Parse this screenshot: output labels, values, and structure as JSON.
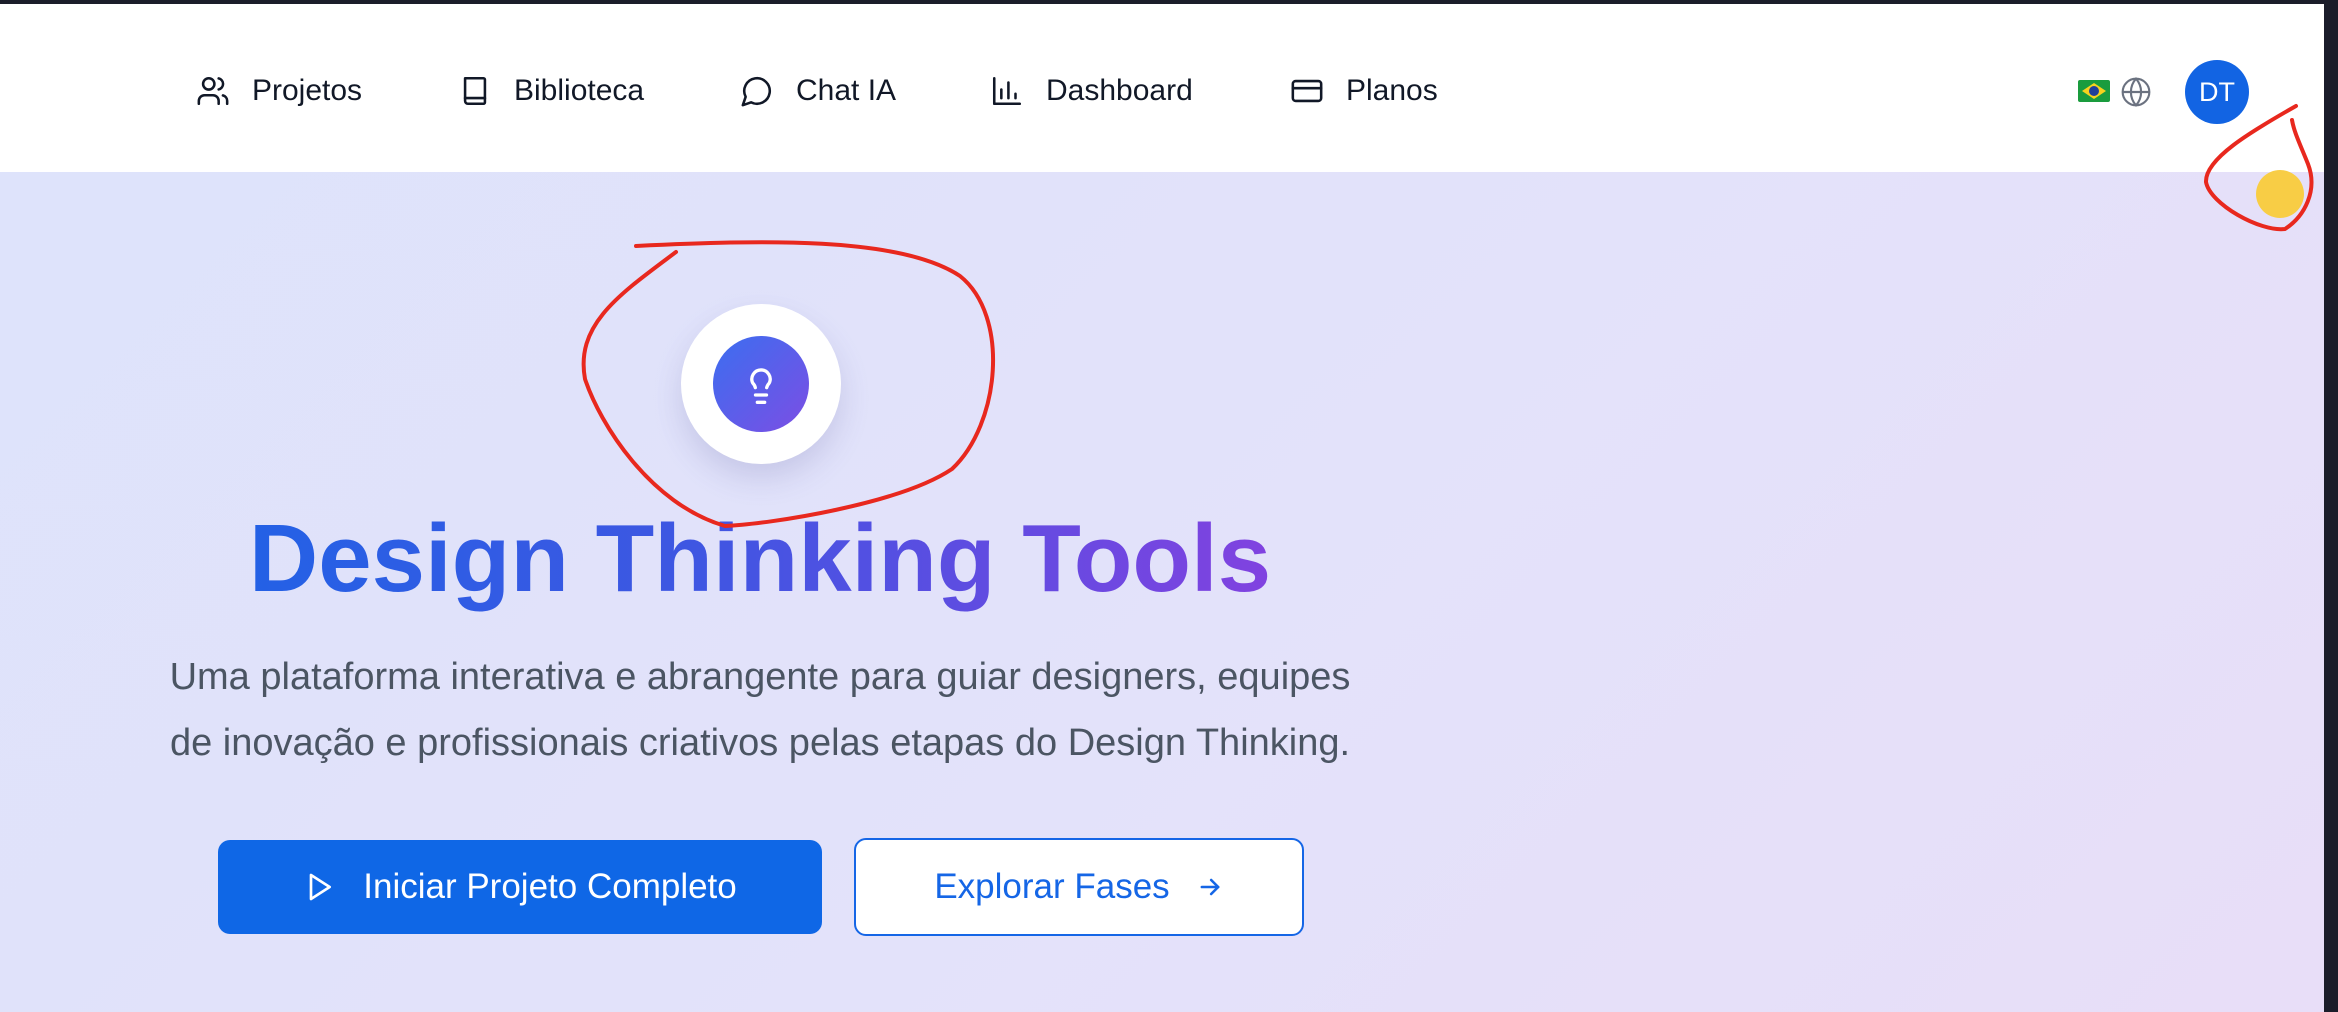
{
  "nav": {
    "items": [
      {
        "label": "Projetos",
        "icon": "users-icon"
      },
      {
        "label": "Biblioteca",
        "icon": "book-icon"
      },
      {
        "label": "Chat IA",
        "icon": "chat-bubble-icon"
      },
      {
        "label": "Dashboard",
        "icon": "bar-chart-icon"
      },
      {
        "label": "Planos",
        "icon": "credit-card-icon"
      }
    ],
    "language_flag": "brazil-flag",
    "language_icon": "globe-icon",
    "avatar_initials": "DT"
  },
  "hero": {
    "icon": "lightbulb-icon",
    "title": "Design Thinking Tools",
    "subtitle_line1": "Uma plataforma interativa e abrangente para guiar designers, equipes",
    "subtitle_line2": "de inovação e profissionais criativos pelas etapas do Design Thinking.",
    "primary_button": "Iniciar Projeto Completo",
    "secondary_button": "Explorar Fases"
  },
  "colors": {
    "primary": "#0f67e6",
    "accent_purple": "#8b3fe0",
    "annotation_red": "#e8281e",
    "yellow_dot": "#f8cd45"
  }
}
